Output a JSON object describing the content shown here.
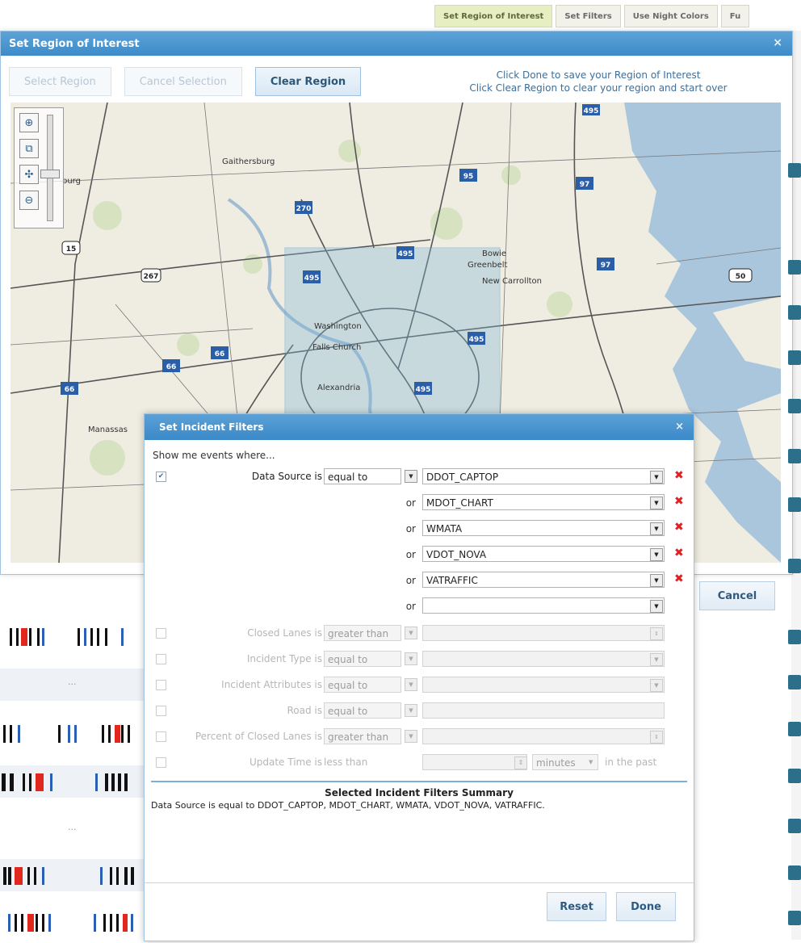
{
  "top_tabs": [
    "Set Region of Interest",
    "Set Filters",
    "Use Night Colors",
    "Fu"
  ],
  "region_window": {
    "title": "Set Region of Interest",
    "close": "×",
    "buttons": {
      "select": "Select Region",
      "cancel_selection": "Cancel Selection",
      "clear": "Clear Region"
    },
    "help_line1": "Click Done to save your Region of Interest",
    "help_line2": "Click Clear Region to clear your region and start over"
  },
  "map": {
    "places": [
      "Gaithersburg",
      "Washington",
      "Falls Church",
      "Alexandria",
      "Bowie",
      "Greenbelt",
      "New Carrollton",
      "Manassas",
      "burg"
    ],
    "shields": [
      "270",
      "495",
      "95",
      "97",
      "495",
      "97",
      "50",
      "66",
      "66",
      "495",
      "495",
      "15",
      "267",
      "495"
    ],
    "zoom_icons": [
      "zoom-in",
      "zoom-box",
      "pan",
      "zoom-out"
    ]
  },
  "list": {
    "ellipsis": "..."
  },
  "cancel_label": "Cancel",
  "filter_dialog": {
    "title": "Set Incident Filters",
    "close": "×",
    "intro": "Show me events where...",
    "data_source": {
      "label": "Data Source is",
      "operator": "equal to",
      "or_label": "or",
      "values": [
        "DDOT_CAPTOP",
        "MDOT_CHART",
        "WMATA",
        "VDOT_NOVA",
        "VATRAFFIC",
        ""
      ]
    },
    "other_filters": [
      {
        "label": "Closed Lanes is",
        "operator": "greater than"
      },
      {
        "label": "Incident Type is",
        "operator": "equal to"
      },
      {
        "label": "Incident Attributes is",
        "operator": "equal to"
      },
      {
        "label": "Road is",
        "operator": "equal to"
      },
      {
        "label": "Percent of Closed Lanes is",
        "operator": "greater than"
      },
      {
        "label": "Update Time is",
        "operator": "less than",
        "unit": "minutes",
        "suffix": "in the past"
      }
    ],
    "summary_title": "Selected Incident Filters Summary",
    "summary_text": "Data Source is equal to DDOT_CAPTOP, MDOT_CHART, WMATA, VDOT_NOVA, VATRAFFIC.",
    "reset": "Reset",
    "done": "Done"
  }
}
